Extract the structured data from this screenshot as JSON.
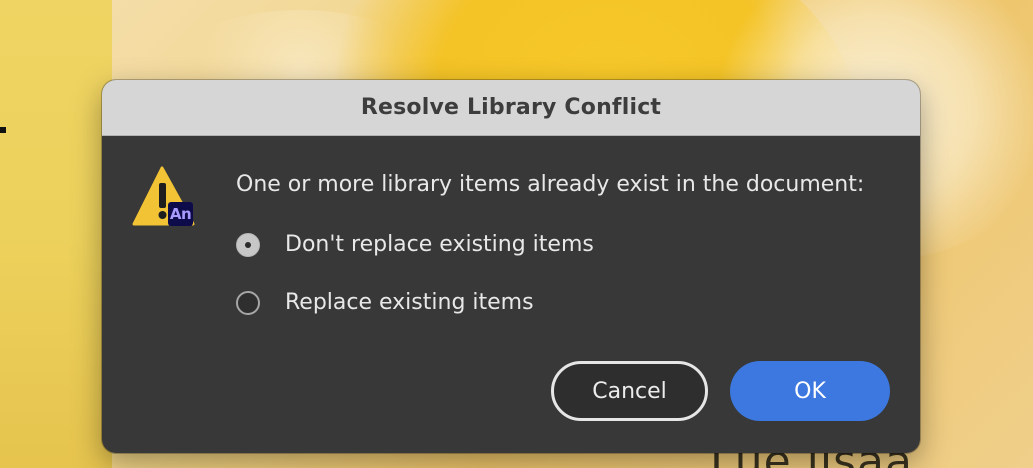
{
  "dialog": {
    "title": "Resolve Library Conflict",
    "message": "One or more library items already exist in the document:",
    "icon": "warning-icon",
    "app_badge": "An",
    "options": [
      {
        "label": "Don't replace existing items",
        "selected": true
      },
      {
        "label": "Replace existing items",
        "selected": false
      }
    ],
    "buttons": {
      "cancel": "Cancel",
      "ok": "OK"
    }
  },
  "background": {
    "partial_text": "Lue lisää"
  },
  "colors": {
    "accent": "#3c78e0",
    "warning": "#f2c335",
    "badge_bg": "#0e0b4a"
  }
}
